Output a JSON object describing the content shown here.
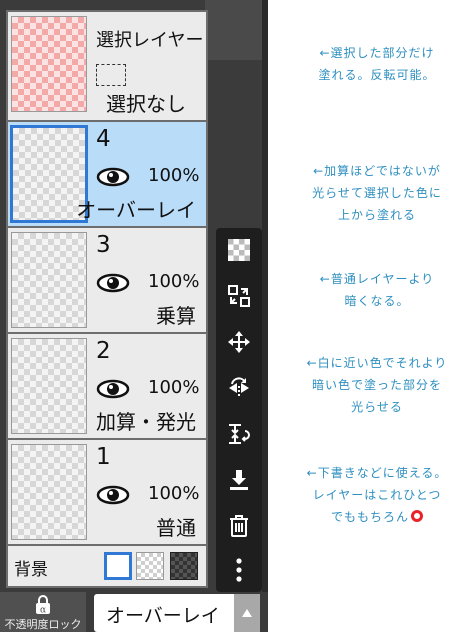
{
  "layers_panel": {
    "selection_layer": {
      "title": "選択レイヤー",
      "status": "選択なし"
    },
    "layers": [
      {
        "number": "4",
        "opacity": "100%",
        "blend_mode": "オーバーレイ",
        "selected": true
      },
      {
        "number": "3",
        "opacity": "100%",
        "blend_mode": "乗算",
        "selected": false
      },
      {
        "number": "2",
        "opacity": "100%",
        "blend_mode": "加算・発光",
        "selected": false
      },
      {
        "number": "1",
        "opacity": "100%",
        "blend_mode": "普通",
        "selected": false
      }
    ],
    "background": {
      "label": "背景"
    }
  },
  "toolbar": {
    "icons": [
      "transparency-checker-icon",
      "layer-move-icon",
      "move-arrows-icon",
      "flip-horizontal-icon",
      "merge-down-icon",
      "import-icon",
      "trash-icon",
      "more-vertical-icon"
    ]
  },
  "bottom_bar": {
    "lock_label": "不透明度ロック",
    "lock_icon_glyph": "α",
    "blend_mode": "オーバーレイ"
  },
  "notes": [
    {
      "lines": [
        "←選択した部分だけ",
        "塗れる。反転可能。"
      ]
    },
    {
      "lines": [
        "←加算ほどではないが",
        "光らせて選択した色に",
        "上から塗れる"
      ]
    },
    {
      "lines": [
        "←普通レイヤーより",
        "暗くなる。"
      ]
    },
    {
      "lines": [
        "←白に近い色でそれより",
        "暗い色で塗った部分を",
        "光らせる"
      ]
    },
    {
      "lines": [
        "←下書きなどに使える。",
        "レイヤーはこれひとつ",
        "でももちろん"
      ]
    }
  ],
  "colors": {
    "note_text": "#2e8fc0",
    "selected_layer_bg": "#b9dcf9",
    "selected_border": "#2f78d4",
    "circle_mark": "#e8232a"
  }
}
